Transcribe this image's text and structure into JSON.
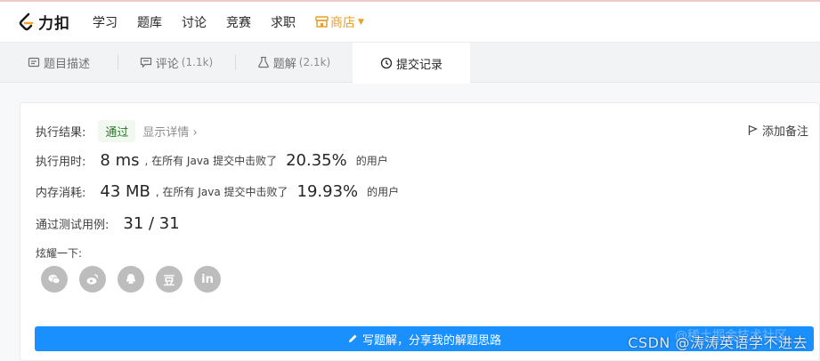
{
  "nav": {
    "brand": "力扣",
    "items": [
      "学习",
      "题库",
      "讨论",
      "竞赛",
      "求职"
    ],
    "store": "商店"
  },
  "tabs": [
    {
      "label": "题目描述",
      "count": "",
      "icon": "document-icon"
    },
    {
      "label": "评论",
      "count": "(1.1k)",
      "icon": "comment-icon"
    },
    {
      "label": "题解",
      "count": "(2.1k)",
      "icon": "flask-icon"
    },
    {
      "label": "提交记录",
      "count": "",
      "icon": "clock-icon"
    }
  ],
  "result": {
    "label": "执行结果:",
    "status": "通过",
    "detail": "显示详情 ›",
    "add_note": "添加备注"
  },
  "runtime": {
    "label": "执行用时:",
    "value": "8 ms",
    "text": ", 在所有 Java 提交中击败了",
    "percent": "20.35%",
    "suffix": "的用户"
  },
  "memory": {
    "label": "内存消耗:",
    "value": "43 MB",
    "text": ", 在所有 Java 提交中击败了",
    "percent": "19.93%",
    "suffix": "的用户"
  },
  "tests": {
    "label": "通过测试用例:",
    "value": "31 / 31"
  },
  "share": {
    "label": "炫耀一下:",
    "buttons": [
      {
        "icon": "wechat-icon",
        "text": ""
      },
      {
        "icon": "weibo-icon",
        "text": ""
      },
      {
        "icon": "qq-icon",
        "text": ""
      },
      {
        "icon": "douban-icon",
        "text": "豆"
      },
      {
        "icon": "linkedin-icon",
        "text": "in"
      }
    ]
  },
  "write_button": "写题解，分享我的解题思路",
  "watermark": "CSDN @涛涛英语学不进去",
  "watermark2": "@稀土掘金技术社区",
  "colors": {
    "accent": "#1a90ff",
    "store": "#e8a02e",
    "success_bg": "#f1f8ef",
    "success_text": "#2a7a2a"
  }
}
